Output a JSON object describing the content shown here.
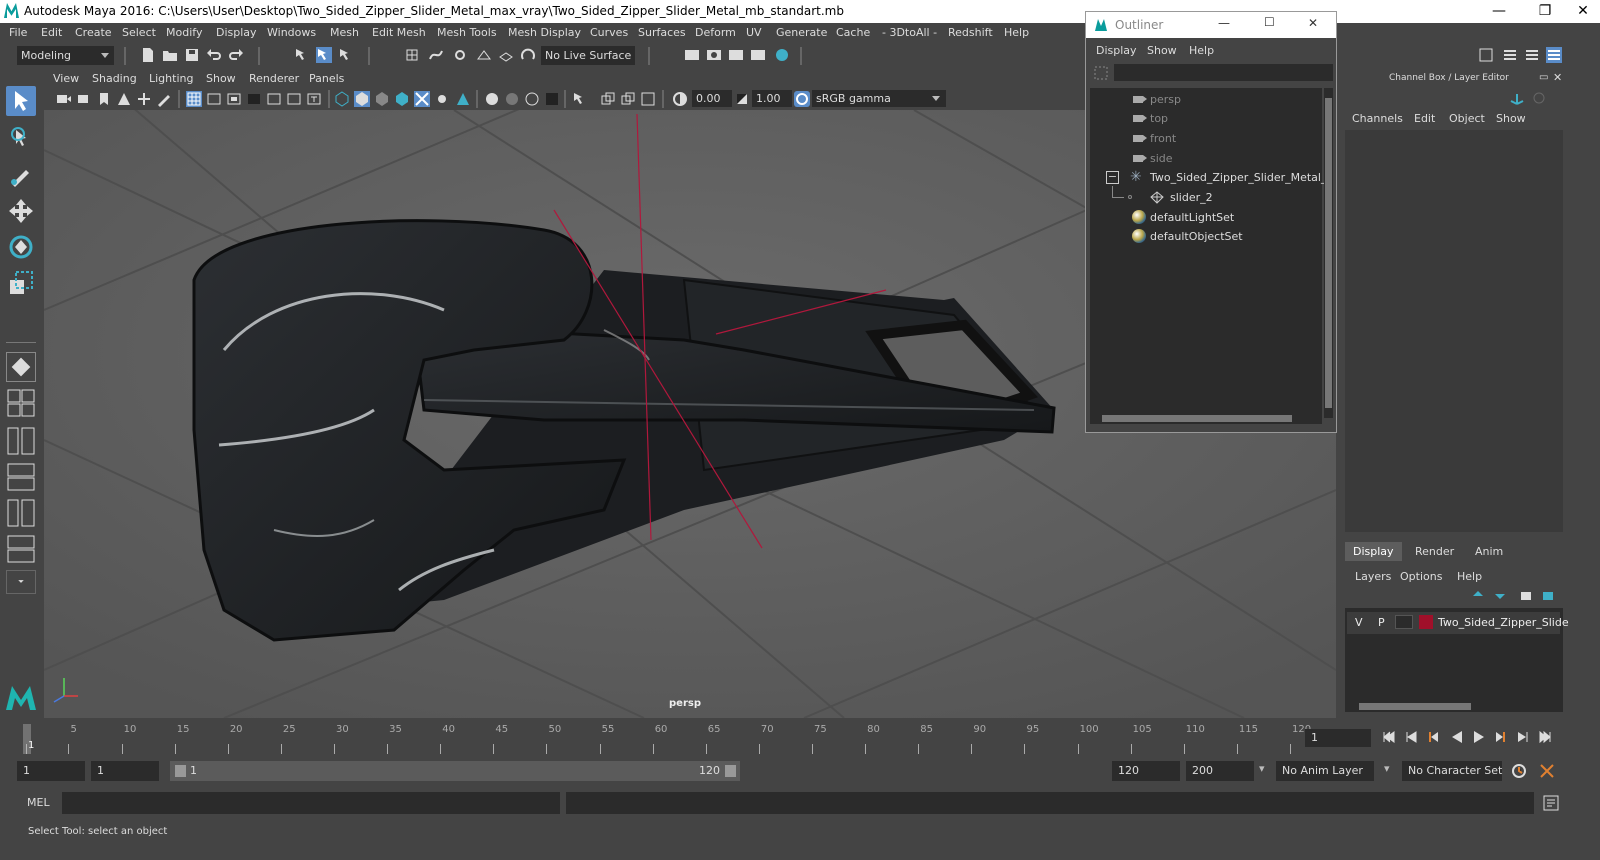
{
  "window": {
    "title": "Autodesk Maya 2016: C:\\Users\\User\\Desktop\\Two_Sided_Zipper_Slider_Metal_max_vray\\Two_Sided_Zipper_Slider_Metal_mb_standart.mb",
    "minimize": "—",
    "restore": "❐",
    "close": "✕"
  },
  "menubar": [
    "File",
    "Edit",
    "Create",
    "Select",
    "Modify",
    "Display",
    "Windows",
    "Mesh",
    "Edit Mesh",
    "Mesh Tools",
    "Mesh Display",
    "Curves",
    "Surfaces",
    "Deform",
    "UV",
    "Generate",
    "Cache",
    "- 3DtoAll -",
    "Redshift",
    "Help"
  ],
  "shelf": {
    "mode": "Modeling",
    "live_surface": "No Live Surface"
  },
  "viewport": {
    "menu": [
      "View",
      "Shading",
      "Lighting",
      "Show",
      "Renderer",
      "Panels"
    ],
    "exposure": "0.00",
    "gamma": "1.00",
    "colorspace": "sRGB gamma",
    "camera": "persp"
  },
  "outliner": {
    "title": "Outliner",
    "menu": [
      "Display",
      "Show",
      "Help"
    ],
    "items": [
      {
        "label": "persp",
        "type": "camera",
        "indent": 1
      },
      {
        "label": "top",
        "type": "camera",
        "indent": 1
      },
      {
        "label": "front",
        "type": "camera",
        "indent": 1
      },
      {
        "label": "side",
        "type": "camera",
        "indent": 1
      },
      {
        "label": "Two_Sided_Zipper_Slider_Metal_n",
        "type": "group",
        "indent": 1
      },
      {
        "label": "slider_2",
        "type": "mesh",
        "indent": 2
      },
      {
        "label": "defaultLightSet",
        "type": "set",
        "indent": 1
      },
      {
        "label": "defaultObjectSet",
        "type": "set",
        "indent": 1
      }
    ]
  },
  "channelbox": {
    "title": "Channel Box / Layer Editor",
    "menu": [
      "Channels",
      "Edit",
      "Object",
      "Show"
    ],
    "tabs": [
      "Display",
      "Render",
      "Anim"
    ],
    "layer_menu": [
      "Layers",
      "Options",
      "Help"
    ],
    "layer": {
      "v": "V",
      "p": "P",
      "name": "Two_Sided_Zipper_Slide",
      "color": "#a0102a"
    }
  },
  "timeline": {
    "ticks": [
      "1",
      "5",
      "10",
      "15",
      "20",
      "25",
      "30",
      "35",
      "40",
      "45",
      "50",
      "55",
      "60",
      "65",
      "70",
      "75",
      "80",
      "85",
      "90",
      "95",
      "100",
      "105",
      "110",
      "115",
      "120"
    ],
    "current_frame": "1"
  },
  "range": {
    "start": "1",
    "playback_start": "1",
    "range_start": "1",
    "range_end": "120",
    "playback_end": "120",
    "end": "200",
    "anim_layer": "No Anim Layer",
    "char_set": "No Character Set"
  },
  "mel": {
    "label": "MEL"
  },
  "status": {
    "text": "Select Tool: select an object"
  }
}
